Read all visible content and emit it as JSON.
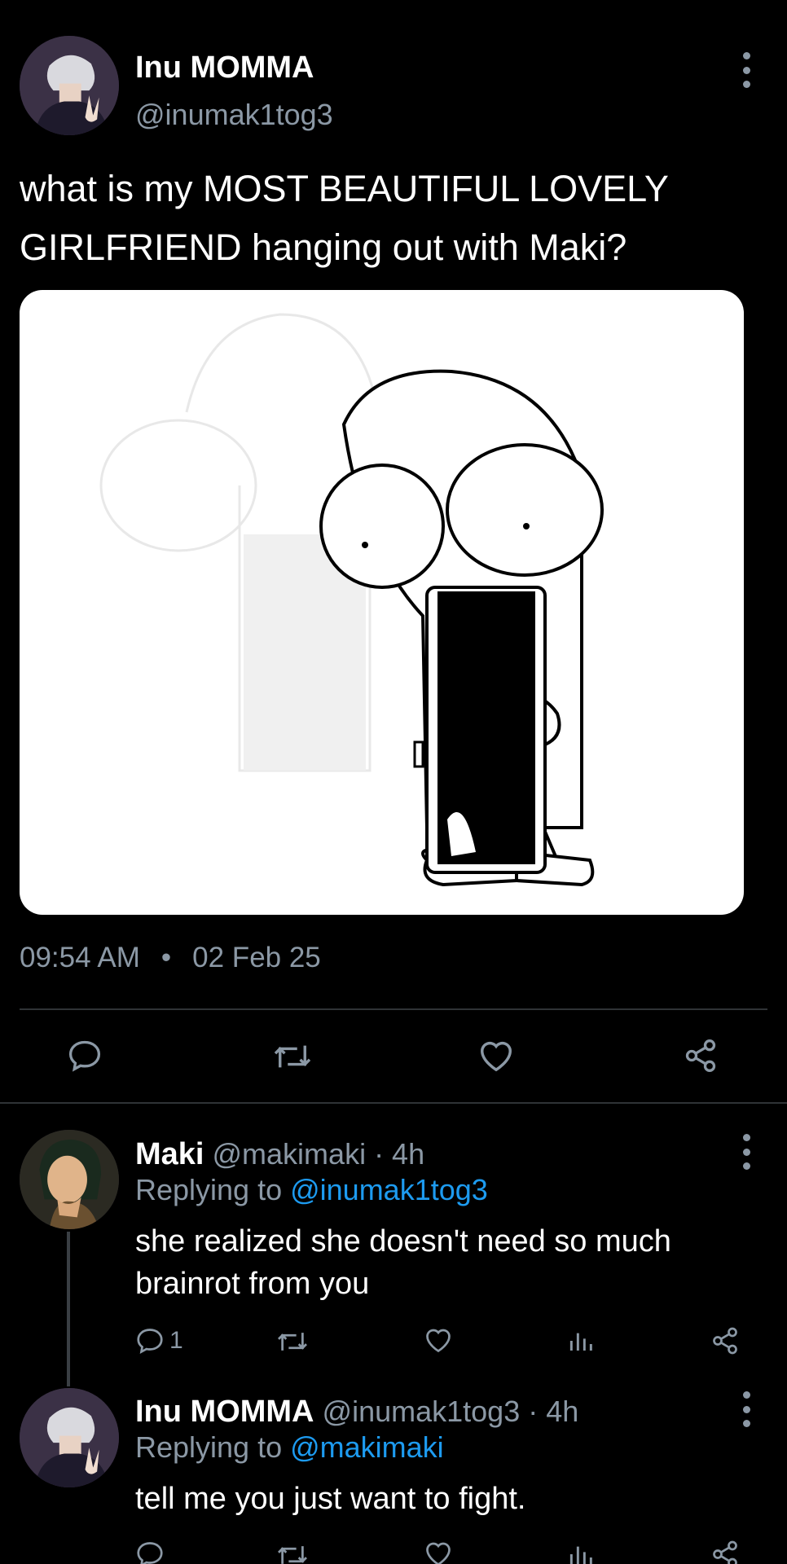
{
  "main_tweet": {
    "author_name": "Inu MOMMA",
    "author_handle": "@inumak1tog3",
    "text": "what is my MOST BEAUTIFUL LOVELY GIRLFRIEND hanging out with Maki?",
    "time": "09:54 AM",
    "separator": "•",
    "date": "02 Feb 25"
  },
  "replies": [
    {
      "name": "Maki",
      "meta": "@makimaki · 4h",
      "replying_prefix": "Replying to ",
      "replying_to": "@inumak1tog3",
      "text": "she realized she doesn't need so much brainrot from you",
      "reply_count": "1"
    },
    {
      "name": "Inu MOMMA",
      "meta": "@inumak1tog3 · 4h",
      "replying_prefix": "Replying to ",
      "replying_to": "@makimaki",
      "text": "tell me you just want to fight."
    }
  ],
  "icons": [
    "reply-icon",
    "retweet-icon",
    "like-icon",
    "share-icon",
    "views-icon",
    "more-icon"
  ],
  "colors": {
    "background": "#000000",
    "secondary_text": "#8b98a5",
    "link": "#1d9bf0",
    "divider": "#2f3336"
  }
}
